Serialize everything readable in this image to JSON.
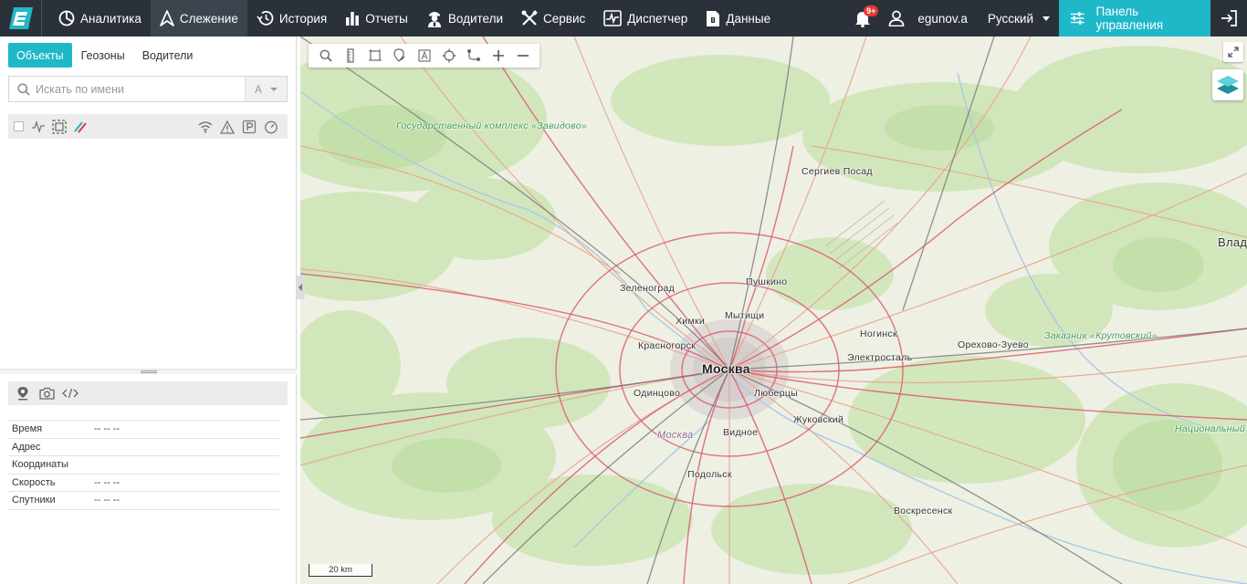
{
  "nav": {
    "items": [
      {
        "label": "Аналитика",
        "icon": "analytics-icon"
      },
      {
        "label": "Слежение",
        "icon": "tracking-arrow-icon",
        "active": true
      },
      {
        "label": "История",
        "icon": "history-icon"
      },
      {
        "label": "Отчеты",
        "icon": "reports-bar-chart-icon"
      },
      {
        "label": "Водители",
        "icon": "driver-icon"
      },
      {
        "label": "Сервис",
        "icon": "service-tools-icon"
      },
      {
        "label": "Диспетчер",
        "icon": "dispatcher-pulse-icon"
      },
      {
        "label": "Данные",
        "icon": "data-file-icon"
      }
    ]
  },
  "top_right": {
    "notifications_badge": "9+",
    "username": "egunov.a",
    "language": "Русский",
    "panel_label": "Панель управления"
  },
  "left": {
    "tabs": [
      "Объекты",
      "Геозоны",
      "Водители"
    ],
    "active_tab": "Объекты",
    "search_placeholder": "Искать по имени",
    "sort_label": "A",
    "info_rows": [
      {
        "key": "Время",
        "value": "-- -- --"
      },
      {
        "key": "Адрес",
        "value": ""
      },
      {
        "key": "Координаты",
        "value": ""
      },
      {
        "key": "Скорость",
        "value": "-- -- --"
      },
      {
        "key": "Спутники",
        "value": "-- -- --"
      }
    ]
  },
  "map": {
    "labels": {
      "zavidovo": "Государственный комплекс «Завидово»",
      "sergiev": "Сергиев Посад",
      "vlad": "Влад",
      "zelenograd": "Зеленоград",
      "pushkino": "Пушкино",
      "khimki": "Химки",
      "mytishchi": "Мытищи",
      "noginsk": "Ногинск",
      "orekhovo": "Орехово-Зуево",
      "zakaznik": "Заказник «Крутовский»",
      "krasnogorsk": "Красногорск",
      "moskva": "Москва",
      "elektrostal": "Электросталь",
      "odintsovo": "Одинцово",
      "lyubertsy": "Люберцы",
      "zhukovsky": "Жуковский",
      "moskva_river": "Москва",
      "vidnoe": "Видное",
      "park": "Национальный парк «Мещера»",
      "podolsk": "Подольск",
      "voskresensk": "Воскресенск"
    },
    "scale": "20 km"
  },
  "colors": {
    "topbar": "#2b3139",
    "accent": "#1fb8c8",
    "badge": "#e53935"
  }
}
